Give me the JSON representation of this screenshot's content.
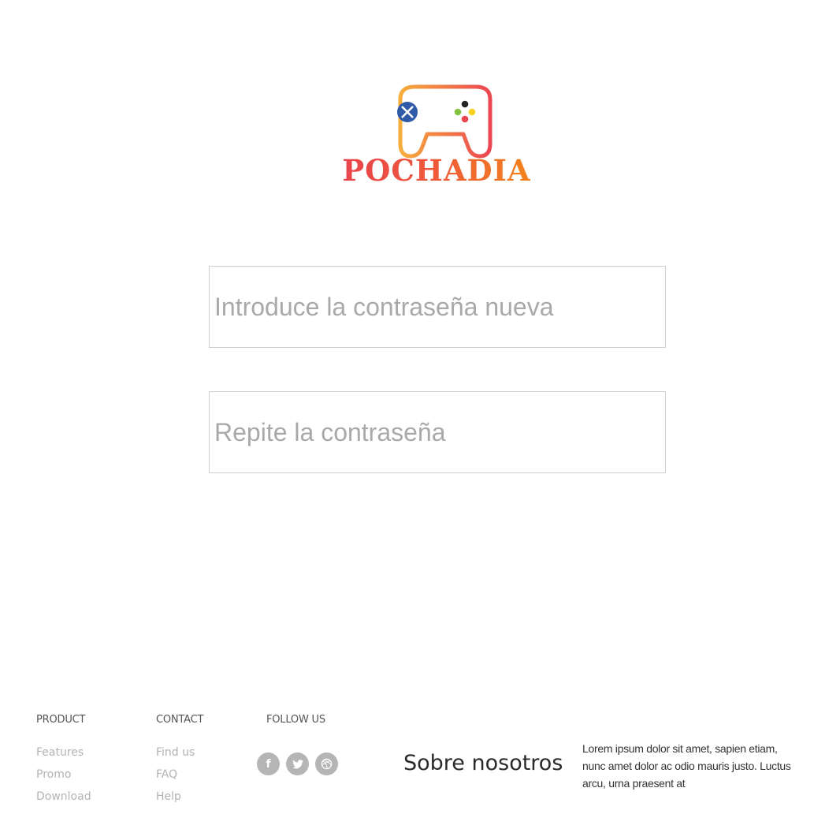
{
  "logo": {
    "text": "POCHADIA",
    "colors": {
      "start": "#f4a83a",
      "end": "#ec4a50",
      "x_button": "#2f5aa8"
    }
  },
  "form": {
    "new_password_placeholder": "Introduce la contraseña nueva",
    "repeat_password_placeholder": "Repite la contraseña"
  },
  "footer": {
    "product": {
      "title": "PRODUCT",
      "links": [
        "Features",
        "Promo",
        "Download"
      ]
    },
    "contact": {
      "title": "CONTACT",
      "links": [
        "Find us",
        "FAQ",
        "Help"
      ]
    },
    "follow": {
      "title": "FOLLOW US",
      "icons": [
        "facebook-icon",
        "twitter-icon",
        "dribbble-icon"
      ]
    },
    "about": {
      "title": "Sobre nosotros",
      "text": "Lorem ipsum dolor sit amet, sapien etiam, nunc amet dolor ac odio mauris justo. Luctus arcu, urna praesent at"
    }
  }
}
